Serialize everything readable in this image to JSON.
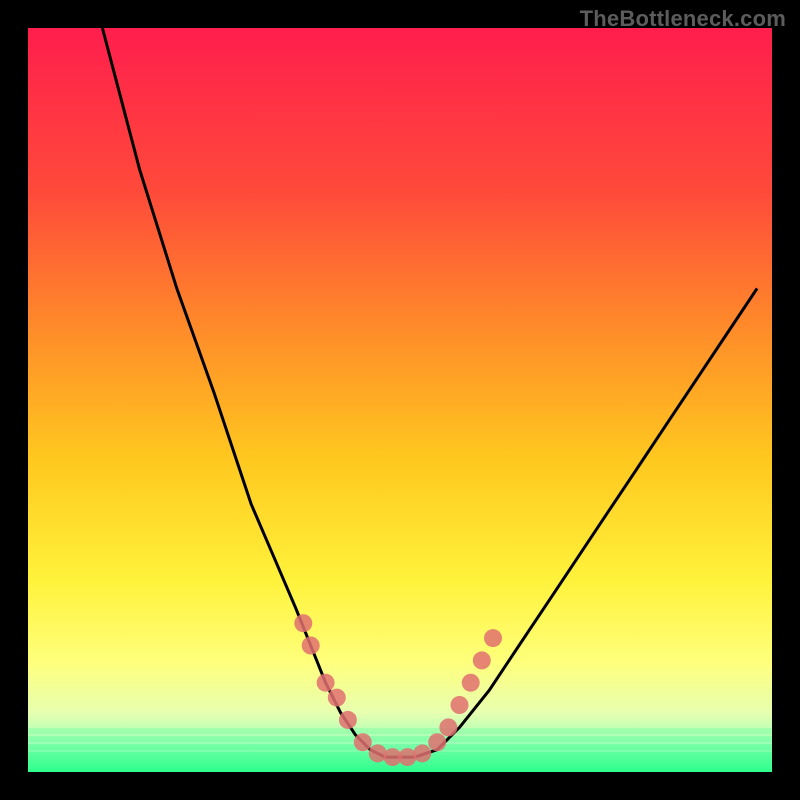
{
  "watermark": "TheBottleneck.com",
  "colors": {
    "background": "#000000",
    "gradient_top": "#ff1e4d",
    "gradient_mid1": "#ff6a2e",
    "gradient_mid2": "#ffd41f",
    "gradient_mid3": "#ffff5a",
    "gradient_mid4": "#e8ff9e",
    "gradient_bottom": "#2fff8d",
    "curve": "#000000",
    "marker": "#e07070"
  },
  "chart_data": {
    "type": "line",
    "title": "",
    "xlabel": "",
    "ylabel": "",
    "xlim": [
      0,
      100
    ],
    "ylim": [
      0,
      100
    ],
    "series": [
      {
        "name": "bottleneck-curve",
        "x": [
          10,
          15,
          20,
          25,
          28,
          30,
          33,
          36,
          38,
          40,
          42,
          44,
          46,
          48,
          50,
          52,
          55,
          58,
          62,
          66,
          70,
          74,
          78,
          82,
          86,
          90,
          94,
          98
        ],
        "y": [
          100,
          81,
          65,
          51,
          42,
          36,
          29,
          22,
          17,
          12,
          8,
          5,
          3,
          2,
          2,
          2,
          3,
          6,
          11,
          17,
          23,
          29,
          35,
          41,
          47,
          53,
          59,
          65
        ]
      }
    ],
    "markers": {
      "name": "data-points",
      "x": [
        37,
        38,
        40,
        41.5,
        43,
        45,
        47,
        49,
        51,
        53,
        55,
        56.5,
        58,
        59.5,
        61,
        62.5
      ],
      "y": [
        20,
        17,
        12,
        10,
        7,
        4,
        2.5,
        2,
        2,
        2.5,
        4,
        6,
        9,
        12,
        15,
        18
      ]
    },
    "green_band": {
      "y_top": 7,
      "y_bottom": 0
    }
  }
}
